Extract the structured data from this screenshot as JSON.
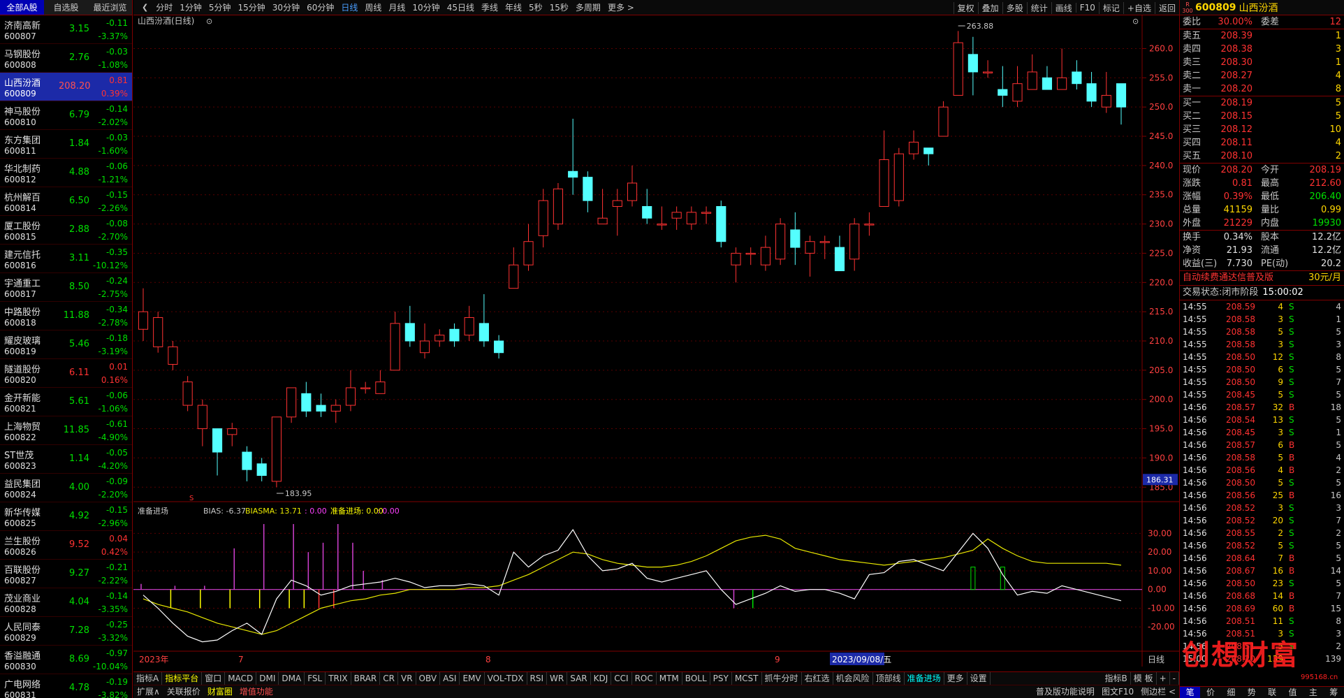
{
  "left": {
    "tabs": [
      "全部A股",
      "自选股",
      "最近浏览"
    ],
    "stocks": [
      {
        "name": "济南高新",
        "code": "600807",
        "price": "3.15",
        "chg": "-0.11",
        "pct": "-3.37%",
        "dir": "g"
      },
      {
        "name": "马钢股份",
        "code": "600808",
        "price": "2.76",
        "chg": "-0.03",
        "pct": "-1.08%",
        "dir": "g"
      },
      {
        "name": "山西汾酒",
        "code": "600809",
        "price": "208.20",
        "chg": "0.81",
        "pct": "0.39%",
        "dir": "r",
        "sel": true
      },
      {
        "name": "神马股份",
        "code": "600810",
        "price": "6.79",
        "chg": "-0.14",
        "pct": "-2.02%",
        "dir": "g"
      },
      {
        "name": "东方集团",
        "code": "600811",
        "price": "1.84",
        "chg": "-0.03",
        "pct": "-1.60%",
        "dir": "g"
      },
      {
        "name": "华北制药",
        "code": "600812",
        "price": "4.88",
        "chg": "-0.06",
        "pct": "-1.21%",
        "dir": "g"
      },
      {
        "name": "杭州解百",
        "code": "600814",
        "price": "6.50",
        "chg": "-0.15",
        "pct": "-2.26%",
        "dir": "g"
      },
      {
        "name": "厦工股份",
        "code": "600815",
        "price": "2.88",
        "chg": "-0.08",
        "pct": "-2.70%",
        "dir": "g"
      },
      {
        "name": "建元信托",
        "code": "600816",
        "price": "3.11",
        "chg": "-0.35",
        "pct": "-10.12%",
        "dir": "g"
      },
      {
        "name": "宇通重工",
        "code": "600817",
        "price": "8.50",
        "chg": "-0.24",
        "pct": "-2.75%",
        "dir": "g"
      },
      {
        "name": "中路股份",
        "code": "600818",
        "price": "11.88",
        "chg": "-0.34",
        "pct": "-2.78%",
        "dir": "g"
      },
      {
        "name": "耀皮玻璃",
        "code": "600819",
        "price": "5.46",
        "chg": "-0.18",
        "pct": "-3.19%",
        "dir": "g"
      },
      {
        "name": "隧道股份",
        "code": "600820",
        "price": "6.11",
        "chg": "0.01",
        "pct": "0.16%",
        "dir": "r"
      },
      {
        "name": "金开新能",
        "code": "600821",
        "price": "5.61",
        "chg": "-0.06",
        "pct": "-1.06%",
        "dir": "g"
      },
      {
        "name": "上海物贸",
        "code": "600822",
        "price": "11.85",
        "chg": "-0.61",
        "pct": "-4.90%",
        "dir": "g"
      },
      {
        "name": "ST世茂",
        "code": "600823",
        "price": "1.14",
        "chg": "-0.05",
        "pct": "-4.20%",
        "dir": "g"
      },
      {
        "name": "益民集团",
        "code": "600824",
        "price": "4.00",
        "chg": "-0.09",
        "pct": "-2.20%",
        "dir": "g"
      },
      {
        "name": "新华传媒",
        "code": "600825",
        "price": "4.92",
        "chg": "-0.15",
        "pct": "-2.96%",
        "dir": "g"
      },
      {
        "name": "兰生股份",
        "code": "600826",
        "price": "9.52",
        "chg": "0.04",
        "pct": "0.42%",
        "dir": "r"
      },
      {
        "name": "百联股份",
        "code": "600827",
        "price": "9.27",
        "chg": "-0.21",
        "pct": "-2.22%",
        "dir": "g"
      },
      {
        "name": "茂业商业",
        "code": "600828",
        "price": "4.04",
        "chg": "-0.14",
        "pct": "-3.35%",
        "dir": "g"
      },
      {
        "name": "人民同泰",
        "code": "600829",
        "price": "7.28",
        "chg": "-0.25",
        "pct": "-3.32%",
        "dir": "g"
      },
      {
        "name": "香溢融通",
        "code": "600830",
        "price": "8.69",
        "chg": "-0.97",
        "pct": "-10.04%",
        "dir": "g"
      },
      {
        "name": "广电网络",
        "code": "600831",
        "price": "4.78",
        "chg": "-0.19",
        "pct": "-3.82%",
        "dir": "g"
      }
    ]
  },
  "toolbar": {
    "items": [
      "分时",
      "1分钟",
      "5分钟",
      "15分钟",
      "30分钟",
      "60分钟",
      "日线",
      "周线",
      "月线",
      "10分钟",
      "45日线",
      "季线",
      "年线",
      "5秒",
      "15秒",
      "多周期",
      "更多 >"
    ],
    "active": "日线",
    "right": [
      "复权",
      "叠加",
      "多股",
      "统计",
      "画线",
      "F10",
      "标记",
      "+自选",
      "返回"
    ]
  },
  "chart": {
    "title": "山西汾酒(日线)",
    "high_label": "263.88",
    "low_label": "183.95",
    "cursor_price": "186.31",
    "y_ticks": [
      "260.0",
      "255.0",
      "250.0",
      "245.0",
      "240.0",
      "235.0",
      "230.0",
      "225.0",
      "220.0",
      "215.0",
      "210.0",
      "205.0",
      "200.0",
      "195.0",
      "190.0",
      "185.0"
    ],
    "indicator_header": {
      "name": "准备进场",
      "bias": "BIAS: -6.37",
      "biasma": "BIASMA: 13.71",
      "v1": ": 0.00",
      "v2": "准备进场: 0.00",
      "v3": ": 0.00"
    },
    "ind_ticks": [
      "30.00",
      "20.00",
      "10.00",
      "0.00",
      "-10.00",
      "-20.00"
    ],
    "x_labels": [
      "2023年",
      "7",
      "8",
      "9"
    ],
    "cursor_date": "2023/09/08/五",
    "period_btn": "日线"
  },
  "chart_data": {
    "type": "candlestick",
    "title": "山西汾酒(日线)",
    "candles": [
      [
        212,
        215,
        210,
        219
      ],
      [
        209,
        214,
        208,
        215
      ],
      [
        206,
        209,
        205,
        210
      ],
      [
        199,
        203,
        198,
        204
      ],
      [
        195,
        199,
        192,
        200
      ],
      [
        195,
        191,
        187,
        195
      ],
      [
        194,
        195,
        192,
        196
      ],
      [
        191,
        188,
        186,
        192
      ],
      [
        189,
        187,
        186,
        190
      ],
      [
        186,
        197,
        185,
        197
      ],
      [
        197,
        202,
        196,
        202
      ],
      [
        201,
        198,
        197,
        203
      ],
      [
        199,
        198,
        197,
        201
      ],
      [
        198,
        199,
        196,
        200
      ],
      [
        199,
        202,
        198,
        205
      ],
      [
        202,
        202,
        201,
        203
      ],
      [
        201,
        203,
        201,
        205
      ],
      [
        205,
        213,
        205,
        215
      ],
      [
        213,
        210,
        209,
        216
      ],
      [
        208,
        210,
        207,
        213
      ],
      [
        210,
        211,
        209,
        212
      ],
      [
        212,
        210,
        209,
        213
      ],
      [
        211,
        214,
        210,
        216
      ],
      [
        213,
        210,
        209,
        218
      ],
      [
        210,
        208,
        207,
        211
      ],
      [
        219,
        223,
        219,
        226
      ],
      [
        223,
        227,
        222,
        230
      ],
      [
        228,
        234,
        226,
        236
      ],
      [
        230,
        236,
        229,
        237
      ],
      [
        239,
        238,
        235,
        248
      ],
      [
        238,
        234,
        232,
        239
      ],
      [
        230,
        231,
        230,
        236
      ],
      [
        233,
        234,
        228,
        236
      ],
      [
        234,
        237,
        233,
        240
      ],
      [
        233,
        231,
        230,
        236
      ],
      [
        230,
        230,
        229,
        233
      ],
      [
        231,
        232,
        229,
        233
      ],
      [
        230,
        232,
        229,
        233
      ],
      [
        232,
        232,
        230,
        233
      ],
      [
        233,
        227,
        226,
        234
      ],
      [
        223,
        225,
        220,
        226
      ],
      [
        225,
        225,
        223,
        226
      ],
      [
        223,
        226,
        222,
        228
      ],
      [
        224,
        230,
        223,
        231
      ],
      [
        229,
        226,
        223,
        232
      ],
      [
        225,
        227,
        221,
        228
      ],
      [
        227,
        227,
        224,
        228
      ],
      [
        226,
        222,
        222,
        228
      ],
      [
        224,
        230,
        222,
        231
      ],
      [
        230,
        230,
        228,
        232
      ],
      [
        233,
        241,
        233,
        246
      ],
      [
        234,
        242,
        233,
        243
      ],
      [
        242,
        244,
        241,
        246
      ],
      [
        243,
        242,
        240,
        243
      ],
      [
        245,
        250,
        245,
        251
      ],
      [
        252,
        261,
        252,
        263
      ],
      [
        259,
        256,
        252,
        262
      ],
      [
        256,
        256,
        255,
        258
      ],
      [
        253,
        252,
        250,
        257
      ],
      [
        251,
        254,
        250,
        257
      ],
      [
        253,
        256,
        253,
        259
      ],
      [
        255,
        253,
        253,
        257
      ],
      [
        253,
        255,
        253,
        260
      ],
      [
        256,
        254,
        253,
        258
      ],
      [
        254,
        251,
        250,
        256
      ],
      [
        250,
        252,
        249,
        256
      ],
      [
        254,
        250,
        247,
        254
      ]
    ],
    "ylim": [
      183,
      264
    ],
    "indicator": {
      "bias": [
        -3,
        -10,
        -18,
        -25,
        -28,
        -27,
        -22,
        -18,
        -24,
        -5,
        5,
        2,
        -3,
        -1,
        2,
        3,
        4,
        6,
        4,
        1,
        2,
        2,
        3,
        2,
        -3,
        20,
        12,
        18,
        21,
        32,
        18,
        10,
        11,
        14,
        6,
        4,
        6,
        8,
        10,
        0,
        -8,
        -5,
        -2,
        2,
        -1,
        0,
        0,
        -2,
        -5,
        8,
        9,
        15,
        16,
        13,
        10,
        20,
        30,
        22,
        8,
        -3,
        -1,
        -2,
        2,
        0,
        -2,
        -4,
        -6
      ],
      "biasma": [
        -5,
        -8,
        -10,
        -12,
        -15,
        -18,
        -20,
        -22,
        -24,
        -22,
        -18,
        -14,
        -10,
        -8,
        -6,
        -5,
        -3,
        -2,
        0,
        0,
        0,
        0,
        1,
        1,
        2,
        5,
        8,
        12,
        16,
        20,
        19,
        16,
        14,
        13,
        12,
        12,
        13,
        15,
        18,
        22,
        26,
        28,
        29,
        27,
        22,
        20,
        18,
        16,
        15,
        14,
        13,
        14,
        15,
        16,
        17,
        19,
        21,
        27,
        22,
        18,
        15,
        14,
        14,
        14,
        14,
        14,
        13
      ],
      "bars": [
        3,
        2,
        -10,
        2,
        -10,
        22,
        -10,
        35,
        -10,
        35,
        -10,
        20,
        -10,
        25,
        -10,
        35,
        -10,
        25,
        10,
        5,
        -10,
        -10
      ],
      "bar_colors": [
        "m",
        "m",
        "y",
        "m",
        "y",
        "m",
        "y",
        "m",
        "y",
        "m",
        "y",
        "m",
        "y",
        "m",
        "r",
        "m",
        "r",
        "m",
        "m",
        "m",
        "m",
        "g"
      ]
    }
  },
  "right": {
    "market_tag": "R 300",
    "code": "600809",
    "name": "山西汾酒",
    "wb": {
      "label1": "委比",
      "v1": "30.00%",
      "label2": "委差",
      "v2": "12"
    },
    "asks": [
      {
        "l": "卖五",
        "p": "208.39",
        "v": "1"
      },
      {
        "l": "卖四",
        "p": "208.38",
        "v": "3"
      },
      {
        "l": "卖三",
        "p": "208.30",
        "v": "1"
      },
      {
        "l": "卖二",
        "p": "208.27",
        "v": "4"
      },
      {
        "l": "卖一",
        "p": "208.20",
        "v": "8"
      }
    ],
    "bids": [
      {
        "l": "买一",
        "p": "208.19",
        "v": "5"
      },
      {
        "l": "买二",
        "p": "208.15",
        "v": "5"
      },
      {
        "l": "买三",
        "p": "208.12",
        "v": "10"
      },
      {
        "l": "买四",
        "p": "208.11",
        "v": "4"
      },
      {
        "l": "买五",
        "p": "208.10",
        "v": "2"
      }
    ],
    "stats": [
      {
        "a": "现价",
        "b": "208.20",
        "bc": "r",
        "c": "今开",
        "d": "208.19",
        "dc": "r"
      },
      {
        "a": "涨跌",
        "b": "0.81",
        "bc": "r",
        "c": "最高",
        "d": "212.60",
        "dc": "r"
      },
      {
        "a": "涨幅",
        "b": "0.39%",
        "bc": "r",
        "c": "最低",
        "d": "206.40",
        "dc": "g"
      },
      {
        "a": "总量",
        "b": "41159",
        "bc": "y",
        "c": "量比",
        "d": "0.99",
        "dc": "y"
      },
      {
        "a": "外盘",
        "b": "21229",
        "bc": "r",
        "c": "内盘",
        "d": "19930",
        "dc": "g"
      }
    ],
    "stats2": [
      {
        "a": "换手",
        "b": "0.34%",
        "bc": "w",
        "c": "股本",
        "d": "12.2亿",
        "dc": "w"
      },
      {
        "a": "净资",
        "b": "21.93",
        "bc": "w",
        "c": "流通",
        "d": "12.2亿",
        "dc": "w"
      },
      {
        "a": "收益(三)",
        "b": "7.730",
        "bc": "w",
        "c": "PE(动)",
        "d": "20.2",
        "dc": "w"
      }
    ],
    "ad": {
      "text": "自动续费通达信普及版",
      "price": "30元/月"
    },
    "status": {
      "label": "交易状态:",
      "value": "闭市阶段",
      "time": "15:00:02"
    },
    "ticks": [
      [
        "14:55",
        "208.59",
        "4",
        "S",
        "4"
      ],
      [
        "14:55",
        "208.58",
        "3",
        "S",
        "1"
      ],
      [
        "14:55",
        "208.58",
        "5",
        "S",
        "5"
      ],
      [
        "14:55",
        "208.58",
        "3",
        "S",
        "3"
      ],
      [
        "14:55",
        "208.50",
        "12",
        "S",
        "8"
      ],
      [
        "14:55",
        "208.50",
        "6",
        "S",
        "5"
      ],
      [
        "14:55",
        "208.50",
        "9",
        "S",
        "7"
      ],
      [
        "14:55",
        "208.45",
        "5",
        "S",
        "5"
      ],
      [
        "14:56",
        "208.57",
        "32",
        "B",
        "18"
      ],
      [
        "14:56",
        "208.54",
        "13",
        "S",
        "5"
      ],
      [
        "14:56",
        "208.45",
        "3",
        "S",
        "1"
      ],
      [
        "14:56",
        "208.57",
        "6",
        "B",
        "5"
      ],
      [
        "14:56",
        "208.58",
        "5",
        "B",
        "4"
      ],
      [
        "14:56",
        "208.56",
        "4",
        "B",
        "2"
      ],
      [
        "14:56",
        "208.50",
        "5",
        "S",
        "5"
      ],
      [
        "14:56",
        "208.56",
        "25",
        "B",
        "16"
      ],
      [
        "14:56",
        "208.52",
        "3",
        "S",
        "3"
      ],
      [
        "14:56",
        "208.52",
        "20",
        "S",
        "7"
      ],
      [
        "14:56",
        "208.55",
        "2",
        "S",
        "2"
      ],
      [
        "14:56",
        "208.52",
        "5",
        "S",
        "5"
      ],
      [
        "14:56",
        "208.64",
        "7",
        "B",
        "5"
      ],
      [
        "14:56",
        "208.67",
        "16",
        "B",
        "14"
      ],
      [
        "14:56",
        "208.50",
        "23",
        "S",
        "5"
      ],
      [
        "14:56",
        "208.68",
        "14",
        "B",
        "7"
      ],
      [
        "14:56",
        "208.69",
        "60",
        "B",
        "15"
      ],
      [
        "14:56",
        "208.51",
        "11",
        "S",
        "8"
      ],
      [
        "14:56",
        "208.51",
        "3",
        "S",
        "3"
      ],
      [
        "14:56",
        "208.51",
        "5",
        "S",
        "2"
      ],
      [
        "15:00",
        "208.20",
        "139",
        "",
        "139"
      ]
    ],
    "tabs": [
      "笔",
      "价",
      "细",
      "势",
      "联",
      "值",
      "主",
      "筹"
    ]
  },
  "ibar": {
    "items": [
      "指标A",
      "指标平台",
      "窗口",
      "MACD",
      "DMI",
      "DMA",
      "FSL",
      "TRIX",
      "BRAR",
      "CR",
      "VR",
      "OBV",
      "ASI",
      "EMV",
      "VOL-TDX",
      "RSI",
      "WR",
      "SAR",
      "KDJ",
      "CCI",
      "ROC",
      "MTM",
      "BOLL",
      "PSY",
      "MCST",
      "抓牛分时",
      "右红选",
      "机会风险",
      "顶部线",
      "准备进场",
      "更多",
      "设置"
    ],
    "right": [
      "指标B",
      "模 板",
      "+",
      "-"
    ]
  },
  "sbar": {
    "items": [
      "扩展∧",
      "关联报价",
      "财富圈",
      "增值功能"
    ],
    "right": [
      "普及版功能说明",
      "图文F10",
      "侧边栏 <"
    ]
  },
  "watermark": {
    "text": "创想财富",
    "url": "995168.cn"
  },
  "colors": {
    "up": "#ff3232",
    "down": "#54ffff",
    "grid": "#800000",
    "bias": "#ffffff",
    "biasma": "#e8e800"
  }
}
